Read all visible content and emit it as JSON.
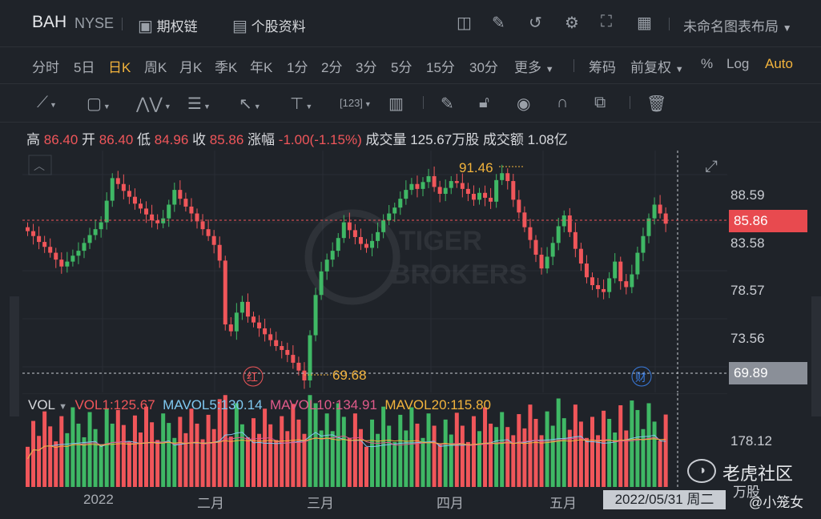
{
  "header": {
    "symbol": "BAH",
    "exchange": "NYSE",
    "option_chain": "期权链",
    "profile": "个股资料",
    "layout_name": "未命名图表布局"
  },
  "periods": [
    "分时",
    "5日",
    "日K",
    "周K",
    "月K",
    "季K",
    "年K",
    "1分",
    "2分",
    "3分",
    "5分",
    "15分",
    "30分",
    "更多"
  ],
  "active_period": "日K",
  "period_right": {
    "chips": "筹码",
    "adjust": "前复权",
    "percent": "%",
    "log": "Log",
    "auto": "Auto"
  },
  "info": {
    "high_label": "高",
    "high": "86.40",
    "open_label": "开",
    "open": "86.40",
    "low_label": "低",
    "low": "84.96",
    "close_label": "收",
    "close": "85.86",
    "change_label": "涨幅",
    "change": "-1.00(-1.15%)",
    "volume_label": "成交量",
    "volume": "125.67万股",
    "turnover_label": "成交额",
    "turnover": "1.08亿"
  },
  "price_axis": [
    "88.59",
    "83.58",
    "78.57",
    "73.56"
  ],
  "current_price": "85.86",
  "cursor_price": "69.89",
  "annotations": {
    "high": "91.46",
    "low": "69.68",
    "red_marker": "红",
    "fin_marker": "财"
  },
  "watermark": {
    "line1": "TIGER",
    "line2": "BROKERS"
  },
  "volume": {
    "label": "VOL",
    "vol1": "VOL1:125.67",
    "ma5": "MAVOL5:130.14",
    "ma10": "MAVOL10:134.91",
    "ma20": "MAVOL20:115.80",
    "axis_top": "178.12",
    "unit": "万股"
  },
  "date_axis": [
    "2022",
    "二月",
    "三月",
    "四月",
    "五月"
  ],
  "cursor_date": "2022/05/31 周二",
  "brand": {
    "name": "老虎社区",
    "user": "@小笼女"
  },
  "colors": {
    "up": "#3fb865",
    "down": "#f0565a",
    "accent": "#f2b33c",
    "ma5": "#7fc8f0",
    "ma10": "#e05a8a",
    "ma20": "#f2b33c"
  },
  "chart_data": {
    "type": "candlestick",
    "ylim": [
      69,
      92
    ],
    "closes": [
      85.1,
      84.6,
      84.0,
      83.5,
      82.9,
      82.2,
      81.5,
      82.0,
      82.6,
      83.1,
      83.9,
      84.7,
      85.3,
      86.0,
      88.2,
      90.5,
      89.9,
      89.2,
      88.6,
      87.9,
      87.4,
      86.8,
      86.2,
      85.9,
      86.4,
      87.8,
      89.3,
      88.4,
      87.6,
      86.9,
      86.1,
      85.3,
      84.6,
      83.7,
      82.1,
      75.6,
      74.9,
      76.8,
      77.9,
      76.4,
      75.8,
      75.2,
      74.6,
      74.0,
      73.4,
      73.0,
      72.5,
      71.7,
      70.9,
      69.9,
      74.5,
      78.6,
      81.0,
      82.2,
      83.1,
      84.4,
      86.0,
      85.2,
      84.5,
      83.8,
      83.4,
      84.1,
      85.0,
      86.2,
      86.9,
      87.5,
      88.4,
      89.3,
      89.9,
      89.4,
      90.1,
      90.7,
      89.6,
      88.9,
      89.5,
      90.2,
      90.0,
      89.4,
      88.9,
      88.3,
      89.0,
      88.5,
      88.1,
      90.3,
      91.0,
      90.2,
      88.3,
      87.0,
      85.5,
      84.2,
      82.7,
      81.3,
      82.5,
      83.9,
      85.6,
      86.7,
      85.0,
      83.3,
      81.8,
      80.4,
      79.6,
      79.2,
      78.9,
      80.3,
      82.0,
      80.0,
      79.4,
      80.7,
      82.9,
      84.6,
      86.4,
      87.8,
      86.9,
      85.86
    ]
  }
}
